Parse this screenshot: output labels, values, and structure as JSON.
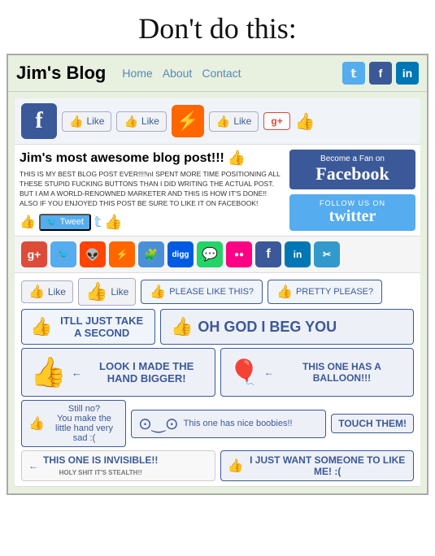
{
  "page": {
    "title": "Don't do this:"
  },
  "nav": {
    "blog_title": "Jim's Blog",
    "links": [
      "Home",
      "About",
      "Contact"
    ]
  },
  "social_top": {
    "like1": "Like",
    "like2": "Like",
    "like3": "Like"
  },
  "post": {
    "title": "Jim's most awesome blog post!!!",
    "body": "THIS IS MY BEST BLOG POST EVER!!!!\nI SPENT MORE TIME POSITIONING ALL THESE STUPID FUCKING BUTTONS THAN I DID WRITING THE ACTUAL POST. BUT I AM A WORLD-RENOWNED MARKETER AND THIS IS HOW IT'S DONE!! ALSO IF YOU ENJOYED THIS POST BE SURE TO LIKE IT ON FACEBOOK!",
    "tweet": "Tweet",
    "fb_fan_become": "Become a Fan on",
    "fb_fan_name": "Facebook",
    "twitter_follow": "Follow Us On",
    "twitter_name": "twitter"
  },
  "buttons": {
    "like1": "Like",
    "like2": "Like",
    "please": "PLEASE LIKE THIS?",
    "pretty_please": "PRETTY PLEASE?",
    "itll": "ITLL JUST TAKE A SECOND",
    "oh_god": "OH GOD I BEG YOU",
    "hand_bigger": "LOOK I MADE THE HAND BIGGER!",
    "balloon": "THIS ONE HAS A BALLOON!!!",
    "still_no": "Still no?\nYou make the little hand very sad :(",
    "boobs": "This one has nice boobies!!",
    "touch": "TOUCH THEM!",
    "invisible": "THIS ONE IS INVISIBLE!!",
    "invisible_sub": "HOLY SHIT IT'S STEALTH!!",
    "like_me": "I JUST WANT SOMEONE TO LIKE ME! :("
  }
}
